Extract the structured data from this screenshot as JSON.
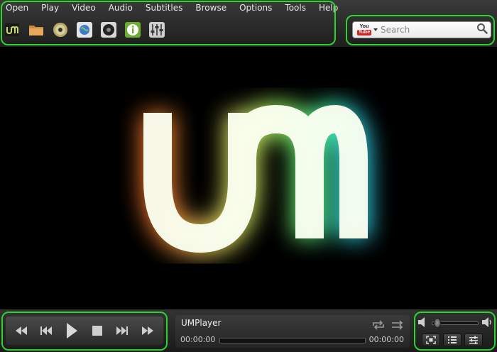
{
  "menu": {
    "items": [
      {
        "id": "open",
        "label": "Open"
      },
      {
        "id": "play",
        "label": "Play"
      },
      {
        "id": "video",
        "label": "Video"
      },
      {
        "id": "audio",
        "label": "Audio"
      },
      {
        "id": "subtitles",
        "label": "Subtitles"
      },
      {
        "id": "browse",
        "label": "Browse"
      },
      {
        "id": "options",
        "label": "Options"
      },
      {
        "id": "tools",
        "label": "Tools"
      },
      {
        "id": "help",
        "label": "Help"
      }
    ]
  },
  "toolbar": {
    "icons": [
      "um-logo-icon",
      "open-folder-icon",
      "open-disc-icon",
      "open-url-icon",
      "media-icon",
      "info-icon",
      "equalizer-icon"
    ]
  },
  "search": {
    "placeholder": "Search",
    "value": "",
    "provider_logo_text_top": "You",
    "provider_logo_text_bottom": "Tube"
  },
  "video": {
    "logo_text": "um"
  },
  "controls": {
    "buttons": [
      "rewind-icon",
      "previous-icon",
      "play-icon",
      "stop-icon",
      "next-icon",
      "fast-forward-icon"
    ]
  },
  "now_playing": {
    "title": "UMPlayer",
    "current_time": "00:00:00",
    "total_time": "00:00:00",
    "progress": 0
  },
  "volume": {
    "level": 0.05
  },
  "colors": {
    "highlight_frame": "#2bd52b",
    "youtube_red": "#d32222"
  }
}
